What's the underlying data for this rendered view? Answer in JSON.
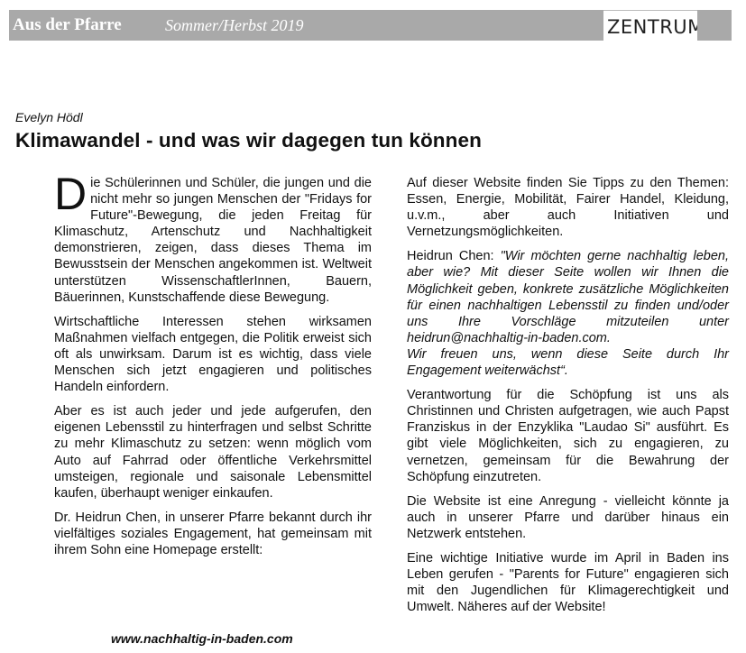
{
  "header": {
    "section": "Aus der Pfarre",
    "season": "Sommer/Herbst 2019",
    "brand": "ZENTRUM"
  },
  "article": {
    "author": "Evelyn Hödl",
    "title": "Klimawandel - und was wir dagegen tun können",
    "dropcap": "D",
    "p1_rest": "ie Schülerinnen und Schüler, die jungen und die nicht mehr so jungen Menschen der \"Fridays for Future\"-Bewegung, die jeden Freitag für Klimaschutz, Artenschutz und Nachhaltigkeit demonstrieren, zeigen, dass dieses Thema im Bewusstsein der Menschen angekommen ist. Weltweit unterstützen WissenschaftlerInnen, Bauern, Bäuerinnen, Kunstschaffende diese Bewegung.",
    "p2": "Wirtschaftliche Interessen stehen wirksamen Maßnahmen vielfach entgegen, die Politik erweist sich oft als unwirksam. Darum ist es wichtig, dass viele Menschen sich jetzt engagieren und politisches Handeln einfordern.",
    "p3": "Aber es ist auch jeder und jede aufgerufen, den eigenen Lebensstil zu hinterfragen und selbst Schritte zu mehr Klimaschutz zu setzen: wenn möglich vom Auto auf Fahrrad oder öffentliche Verkehrsmittel umsteigen, regionale und saisonale Lebensmittel kaufen, überhaupt weniger einkaufen.",
    "p4": "Dr. Heidrun Chen, in unserer Pfarre bekannt durch ihr vielfältiges soziales Engagement, hat gemeinsam mit ihrem Sohn eine Homepage erstellt:",
    "url": "www.nachhaltig-in-baden.com",
    "p5": "Auf dieser Website finden Sie Tipps zu den Themen: Essen, Energie, Mobilität, Fairer Handel, Kleidung, u.v.m., aber auch Initiativen und Vernetzungsmöglichkeiten.",
    "p6_lead": "Heidrun Chen: ",
    "p6_quote": "\"Wir möchten gerne nachhaltig leben, aber wie? Mit dieser Seite wollen wir Ihnen die Möglichkeit geben, konkrete zusätzliche Möglichkeiten für einen nachhaltigen Lebensstil zu finden und/oder uns Ihre Vorschläge mitzuteilen unter heidrun@nachhaltig-in-baden.com.",
    "p6_quote2": "Wir freuen uns, wenn diese Seite durch Ihr Engagement weiterwächst“.",
    "p7": "Verantwortung für die Schöpfung ist uns als Christinnen und Christen aufgetragen, wie auch Papst Franziskus in der Enzyklika \"Laudao Si\" ausführt. Es gibt viele Möglichkeiten, sich zu engagieren, zu vernetzen, gemeinsam für die Bewahrung der Schöpfung einzutreten.",
    "p8": "Die Website ist eine Anregung - vielleicht könnte ja auch in unserer Pfarre und darüber hinaus ein Netzwerk entstehen.",
    "p9": "Eine wichtige Initiative wurde im April in Baden ins Leben gerufen - \"Parents for Future\" engagieren sich mit den Jugendlichen für Klimagerechtigkeit und Umwelt. Näheres auf der Website!"
  }
}
